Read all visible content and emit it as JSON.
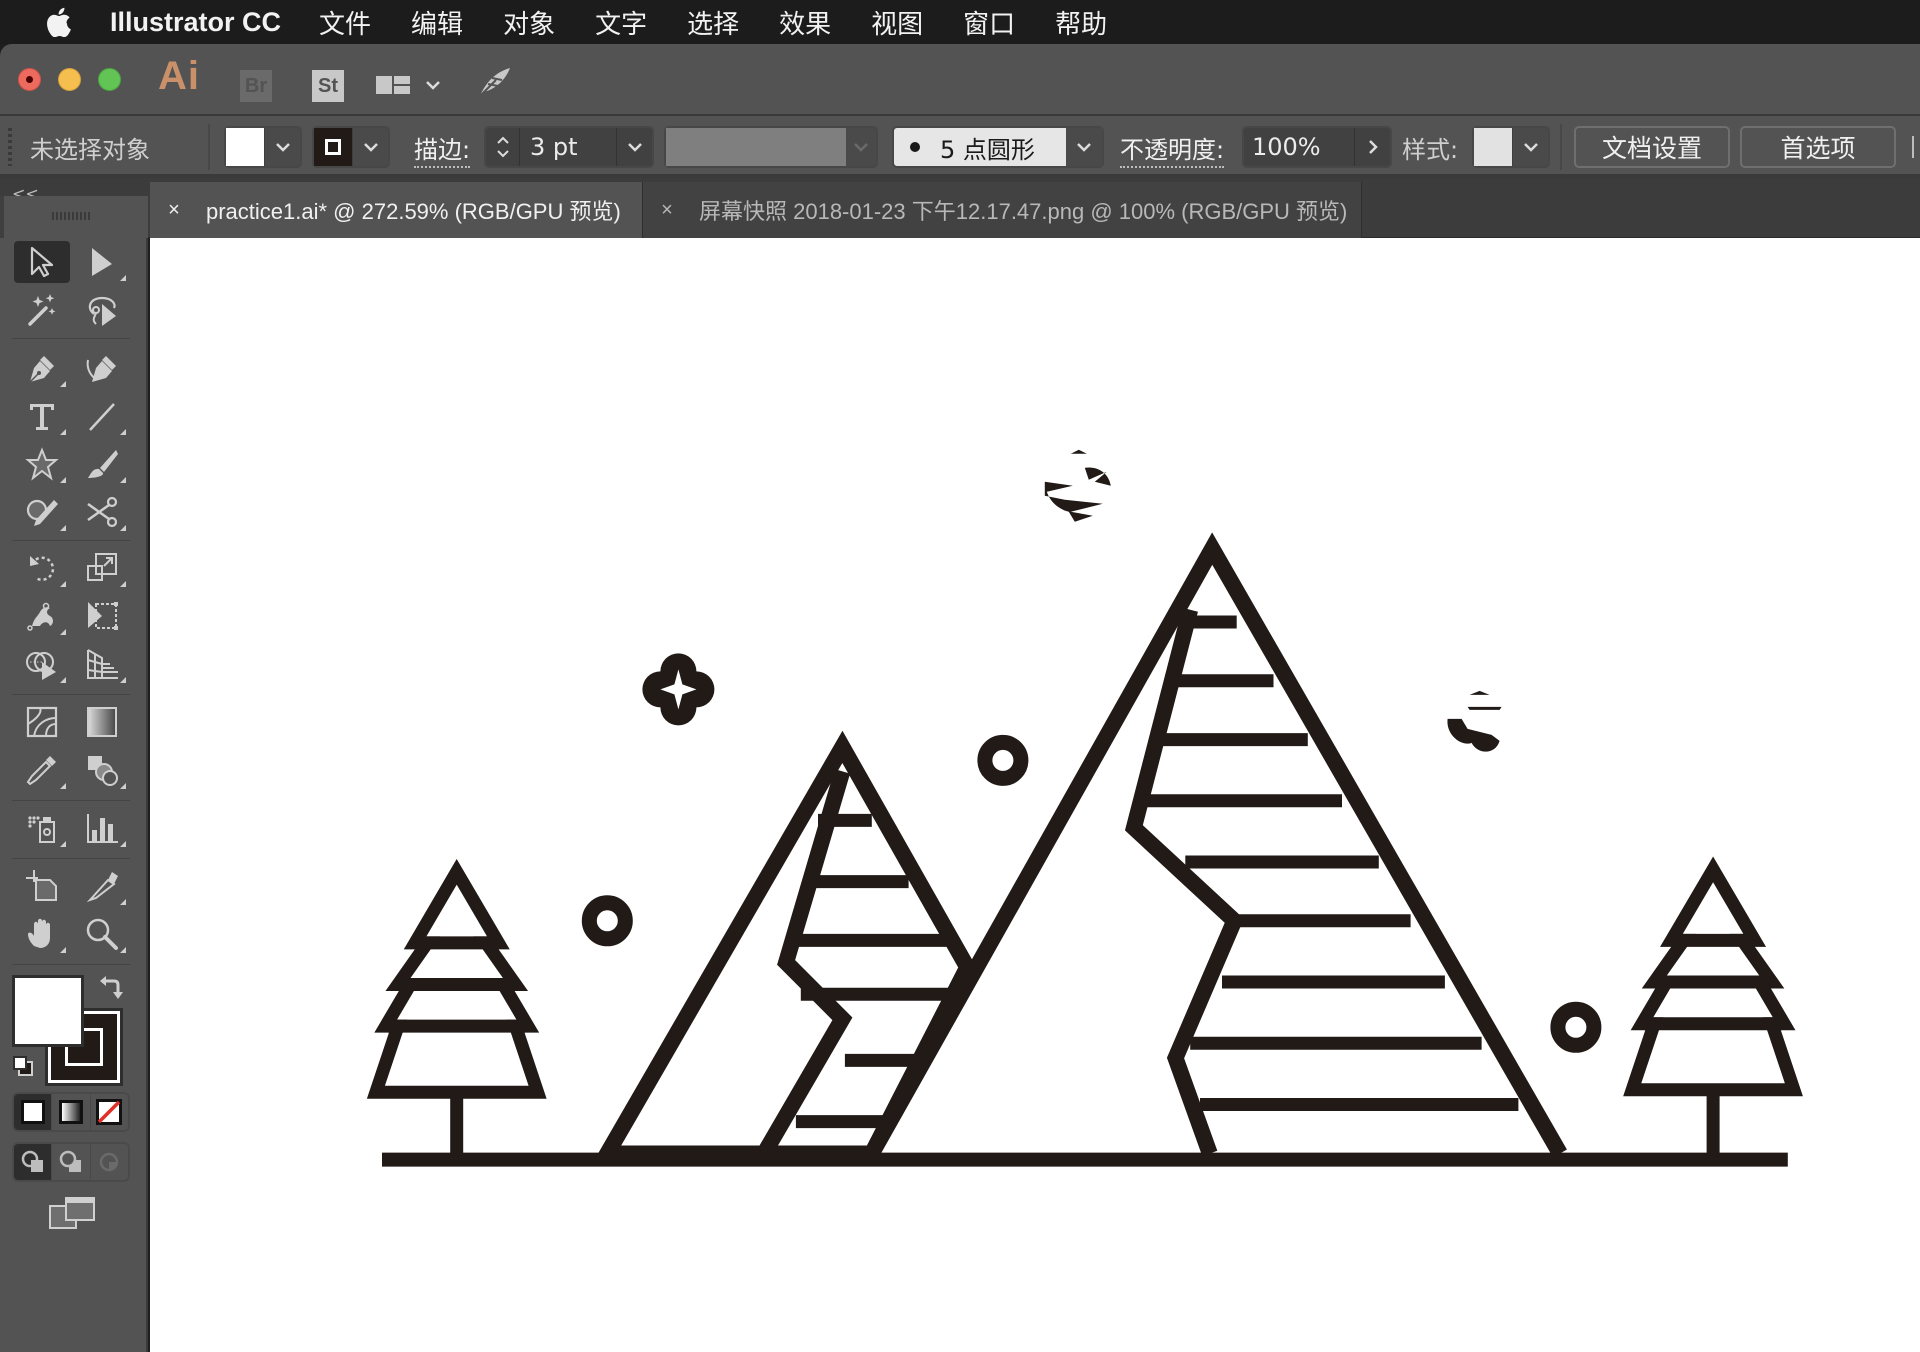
{
  "menubar": {
    "app_name": "Illustrator CC",
    "items": [
      "文件",
      "编辑",
      "对象",
      "文字",
      "选择",
      "效果",
      "视图",
      "窗口",
      "帮助"
    ]
  },
  "appbar": {
    "ai_label": "Ai",
    "br_label": "Br",
    "st_label": "St"
  },
  "control": {
    "selection_status": "未选择对象",
    "fill_color": "#ffffff",
    "stroke_color": "#211a17",
    "stroke_label": "描边:",
    "stroke_weight": "3 pt",
    "brush_label": "5 点圆形",
    "opacity_label": "不透明度:",
    "opacity_value": "100%",
    "style_label": "样式:",
    "doc_setup_button": "文档设置",
    "preferences_button": "首选项"
  },
  "tabs": [
    {
      "label": "practice1.ai* @ 272.59% (RGB/GPU 预览)",
      "active": true
    },
    {
      "label": "屏幕快照 2018-01-23 下午12.17.47.png @ 100% (RGB/GPU 预览)",
      "active": false
    }
  ],
  "tools": [
    "selection-tool",
    "direct-selection-tool",
    "magic-wand-tool",
    "lasso-tool",
    "pen-tool",
    "curvature-tool",
    "type-tool",
    "line-segment-tool",
    "star-tool",
    "paintbrush-tool",
    "shaper-tool",
    "scissors-tool",
    "rotate-tool",
    "scale-tool",
    "puppet-warp-tool",
    "free-transform-tool",
    "shape-builder-tool",
    "perspective-grid-tool",
    "mesh-tool",
    "gradient-tool",
    "eyedropper-tool",
    "blend-tool",
    "symbol-sprayer-tool",
    "column-graph-tool",
    "artboard-tool",
    "slice-tool",
    "hand-tool",
    "zoom-tool"
  ],
  "colors": {
    "ink": "#211a17",
    "panel": "#535353",
    "canvas": "#ffffff"
  },
  "collapse_label": "<<",
  "close_glyph": "×"
}
